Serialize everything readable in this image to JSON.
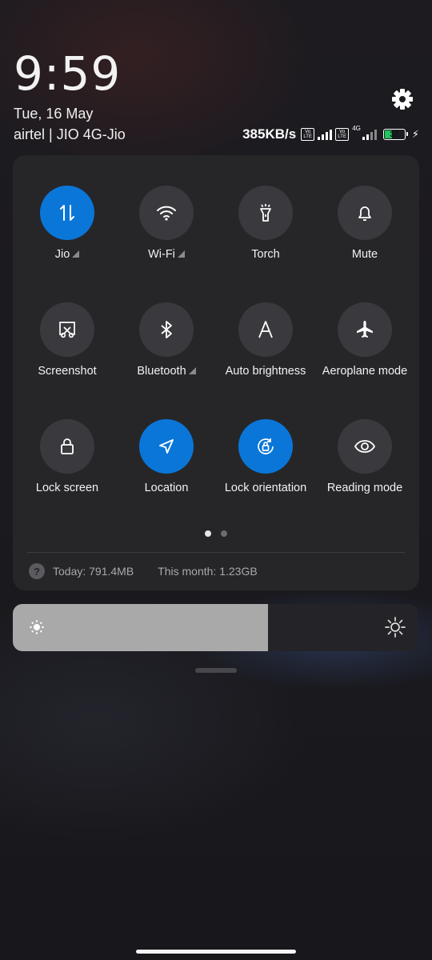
{
  "header": {
    "time": "9:59",
    "date": "Tue, 16 May",
    "carrier": "airtel | JIO 4G-Jio",
    "settings_icon": "gear-icon"
  },
  "status_bar": {
    "net_speed": "385KB/s",
    "volte_label": "Vo LTE",
    "network_type": "4G",
    "battery_level": "32",
    "battery_color": "#22c55e",
    "charging_icon": "bolt-icon"
  },
  "quick_settings": {
    "accent": "#0a76d8",
    "tiles": [
      {
        "label": "Jio",
        "icon": "mobile-data-icon",
        "active": true,
        "expandable": true
      },
      {
        "label": "Wi-Fi",
        "icon": "wifi-icon",
        "active": false,
        "expandable": true
      },
      {
        "label": "Torch",
        "icon": "torch-icon",
        "active": false,
        "expandable": false
      },
      {
        "label": "Mute",
        "icon": "bell-icon",
        "active": false,
        "expandable": false
      },
      {
        "label": "Screenshot",
        "icon": "screenshot-icon",
        "active": false,
        "expandable": false
      },
      {
        "label": "Bluetooth",
        "icon": "bluetooth-icon",
        "active": false,
        "expandable": true
      },
      {
        "label": "Auto brightness",
        "icon": "auto-brightness-icon",
        "active": false,
        "expandable": false
      },
      {
        "label": "Aeroplane mode",
        "icon": "airplane-icon",
        "active": false,
        "expandable": false
      },
      {
        "label": "Lock screen",
        "icon": "lock-icon",
        "active": false,
        "expandable": false
      },
      {
        "label": "Location",
        "icon": "location-icon",
        "active": true,
        "expandable": false
      },
      {
        "label": "Lock orientation",
        "icon": "rotation-lock-icon",
        "active": true,
        "expandable": false
      },
      {
        "label": "Reading mode",
        "icon": "eye-icon",
        "active": false,
        "expandable": false
      }
    ],
    "page_indicator": {
      "current": 1,
      "total": 2
    }
  },
  "data_usage": {
    "help_icon": "?",
    "today": "Today: 791.4MB",
    "this_month": "This month: 1.23GB"
  },
  "brightness": {
    "level": 0.63
  }
}
